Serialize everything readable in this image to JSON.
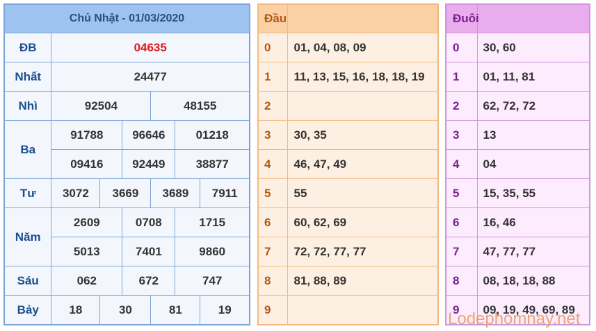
{
  "results": {
    "title": "Chủ Nhật - 01/03/2020",
    "special_color": "#dd1a1a",
    "rows": {
      "db": {
        "label": "ĐB",
        "values": [
          "04635"
        ]
      },
      "nhat": {
        "label": "Nhất",
        "values": [
          "24477"
        ]
      },
      "nhi": {
        "label": "Nhì",
        "values": [
          "92504",
          "48155"
        ]
      },
      "ba": {
        "label": "Ba",
        "values": [
          "91788",
          "96646",
          "01218",
          "09416",
          "92449",
          "38877"
        ]
      },
      "tu": {
        "label": "Tư",
        "values": [
          "3072",
          "3669",
          "3689",
          "7911"
        ]
      },
      "nam": {
        "label": "Năm",
        "values": [
          "2609",
          "0708",
          "1715",
          "5013",
          "7401",
          "9860"
        ]
      },
      "sau": {
        "label": "Sáu",
        "values": [
          "062",
          "672",
          "747"
        ]
      },
      "bay": {
        "label": "Bảy",
        "values": [
          "18",
          "30",
          "81",
          "19"
        ]
      }
    }
  },
  "dau": {
    "header": "Đầu",
    "rows": [
      {
        "key": "0",
        "value": "01, 04, 08, 09"
      },
      {
        "key": "1",
        "value": "11, 13, 15, 16, 18, 18, 19"
      },
      {
        "key": "2",
        "value": ""
      },
      {
        "key": "3",
        "value": "30, 35"
      },
      {
        "key": "4",
        "value": "46, 47, 49"
      },
      {
        "key": "5",
        "value": "55"
      },
      {
        "key": "6",
        "value": "60, 62, 69"
      },
      {
        "key": "7",
        "value": "72, 72, 77, 77"
      },
      {
        "key": "8",
        "value": "81, 88, 89"
      },
      {
        "key": "9",
        "value": ""
      }
    ]
  },
  "duoi": {
    "header": "Đuôi",
    "rows": [
      {
        "key": "0",
        "value": "30, 60"
      },
      {
        "key": "1",
        "value": "01, 11, 81"
      },
      {
        "key": "2",
        "value": "62, 72, 72"
      },
      {
        "key": "3",
        "value": "13"
      },
      {
        "key": "4",
        "value": "04"
      },
      {
        "key": "5",
        "value": "15, 35, 55"
      },
      {
        "key": "6",
        "value": "16, 46"
      },
      {
        "key": "7",
        "value": "47, 77, 77"
      },
      {
        "key": "8",
        "value": "08, 18, 18, 88"
      },
      {
        "key": "9",
        "value": "09, 19, 49, 69, 89"
      }
    ]
  },
  "watermark": "Lodephomnay.net"
}
